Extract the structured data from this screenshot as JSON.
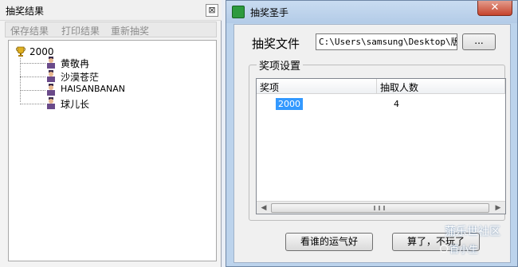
{
  "results_panel": {
    "title": "抽奖结果",
    "close_label": "⊠",
    "toolbar": [
      "保存结果",
      "打印结果",
      "重新抽奖"
    ],
    "tree": {
      "root_label": "2000",
      "winners": [
        "黄敬冉",
        "沙漠苍茫",
        "HAISANBANAN",
        "球儿长"
      ]
    }
  },
  "main_window": {
    "title": "抽奖圣手",
    "close_label": "✕",
    "file_label": "抽奖文件",
    "file_path": "C:\\Users\\samsung\\Desktop\\版块",
    "browse_label": "...",
    "group_title": "奖项设置",
    "list": {
      "columns": [
        "奖项",
        "抽取人数"
      ],
      "rows": [
        {
          "prize": "2000",
          "count": "4"
        }
      ]
    },
    "buttons": {
      "lucky": "看谁的运气好",
      "quit": "算了，不玩了"
    }
  },
  "watermark": {
    "line1": "蒲乐世社区",
    "line2": "百小生"
  }
}
